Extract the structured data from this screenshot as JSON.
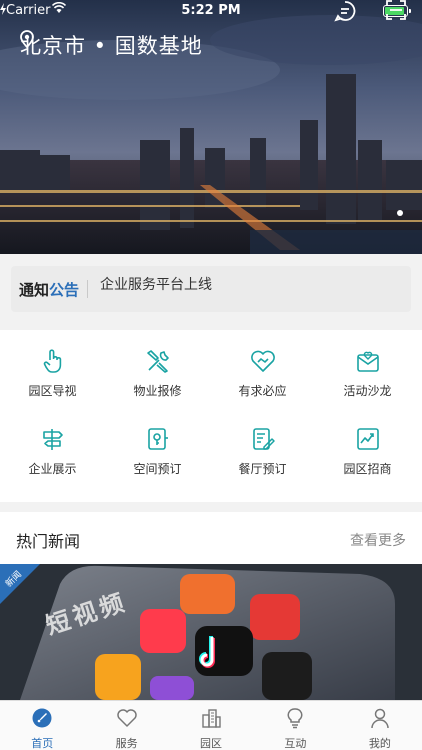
{
  "status_bar": {
    "carrier": "Carrier",
    "time": "5:22 PM"
  },
  "header": {
    "location": "北京市 • 国数基地"
  },
  "notice": {
    "tag_part1": "通知",
    "tag_part2": "公告",
    "text": "企业服务平台上线"
  },
  "services": [
    {
      "label": "园区导视",
      "icon": "hand-pointer-icon"
    },
    {
      "label": "物业报修",
      "icon": "tools-icon"
    },
    {
      "label": "有求必应",
      "icon": "handshake-heart-icon"
    },
    {
      "label": "活动沙龙",
      "icon": "heart-mail-icon"
    },
    {
      "label": "企业展示",
      "icon": "signpost-icon"
    },
    {
      "label": "空间预订",
      "icon": "door-key-icon"
    },
    {
      "label": "餐厅预订",
      "icon": "menu-pen-icon"
    },
    {
      "label": "园区招商",
      "icon": "growth-chart-icon"
    }
  ],
  "news": {
    "title": "热门新闻",
    "more": "查看更多",
    "badge": "新闻",
    "image_text": "短视频"
  },
  "tabbar": [
    {
      "label": "首页",
      "active": true
    },
    {
      "label": "服务",
      "active": false
    },
    {
      "label": "园区",
      "active": false
    },
    {
      "label": "互动",
      "active": false
    },
    {
      "label": "我的",
      "active": false
    }
  ],
  "colors": {
    "accent": "#2b6fb8",
    "icon_teal": "#1aa3a3"
  }
}
